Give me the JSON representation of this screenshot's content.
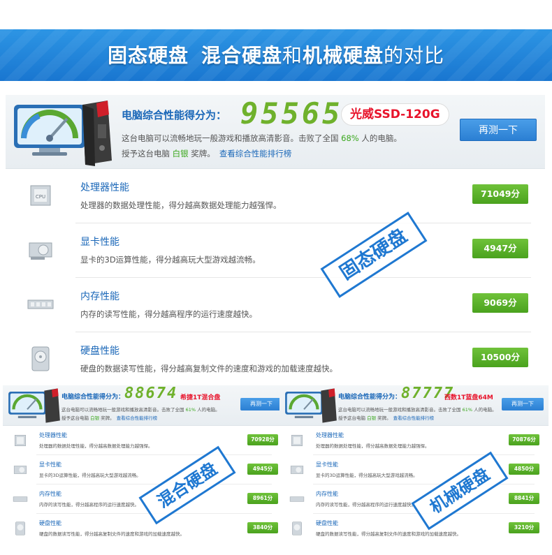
{
  "banner": {
    "part1": "固态硬盘",
    "part2": "混合硬盘",
    "part3": "和",
    "part4": "机械硬盘",
    "part5": "的对比"
  },
  "main": {
    "score_label": "电脑综合性能得分为：",
    "score": "95565",
    "model": "光威SSD-120G",
    "desc_before": "这台电脑可以流畅地玩一般游戏和播放高清影音。击败了全国 ",
    "pct": "68%",
    "desc_after": " 人的电脑。",
    "award_before": "授予这台电脑 ",
    "medal": "白银",
    "award_after": " 奖牌。",
    "rank_link": "查看综合性能排行榜",
    "retest": "再测一下",
    "rows": [
      {
        "title": "处理器性能",
        "desc": "处理器的数据处理性能，得分越高数据处理能力越强悍。",
        "score": "71049分"
      },
      {
        "title": "显卡性能",
        "desc": "显卡的3D运算性能，得分越高玩大型游戏越流畅。",
        "score": "4947分"
      },
      {
        "title": "内存性能",
        "desc": "内存的读写性能，得分越高程序的运行速度越快。",
        "score": "9069分"
      },
      {
        "title": "硬盘性能",
        "desc": "硬盘的数据读写性能，得分越高复制文件的速度和游戏的加载速度越快。",
        "score": "10500分"
      }
    ],
    "stamp": "固态硬盘"
  },
  "hybrid": {
    "score_label": "电脑综合性能得分为：",
    "score": "88674",
    "model": "希捷1T混合盘",
    "desc_before": "这台电脑可以流畅地玩一般游戏和播放高清影音。击败了全国 ",
    "pct": "61%",
    "desc_after": " 人的电脑。",
    "award_before": "授予这台电脑 ",
    "medal": "白银",
    "award_after": " 奖牌。",
    "rank_link": "查看综合性能排行榜",
    "retest": "再测一下",
    "rows": [
      {
        "title": "处理器性能",
        "desc": "处理器的数据处理性能，得分越高数据处理能力越强悍。",
        "score": "70928分"
      },
      {
        "title": "显卡性能",
        "desc": "显卡的3D运算性能，得分越高玩大型游戏越流畅。",
        "score": "4945分"
      },
      {
        "title": "内存性能",
        "desc": "内存的读写性能，得分越高程序的运行速度越快。",
        "score": "8961分"
      },
      {
        "title": "硬盘性能",
        "desc": "硬盘的数据读写性能，得分越高复制文件的速度和游戏的加载速度越快。",
        "score": "3840分"
      }
    ],
    "stamp": "混合硬盘"
  },
  "mechanical": {
    "score_label": "电脑综合性能得分为：",
    "score": "87777",
    "model": "西数1T蓝盘64M",
    "desc_before": "这台电脑可以流畅地玩一般游戏和播放高清影音。击败了全国 ",
    "pct": "61%",
    "desc_after": " 人的电脑。",
    "award_before": "授予这台电脑 ",
    "medal": "白银",
    "award_after": " 奖牌。",
    "rank_link": "查看综合性能排行榜",
    "retest": "再测一下",
    "rows": [
      {
        "title": "处理器性能",
        "desc": "处理器的数据处理性能，得分越高数据处理能力越强悍。",
        "score": "70876分"
      },
      {
        "title": "显卡性能",
        "desc": "显卡的3D运算性能，得分越高玩大型游戏越流畅。",
        "score": "4850分"
      },
      {
        "title": "内存性能",
        "desc": "内存的读写性能，得分越高程序的运行速度越快。",
        "score": "8841分"
      },
      {
        "title": "硬盘性能",
        "desc": "硬盘的数据读写性能，得分越高复制文件的速度和游戏的加载速度越快。",
        "score": "3210分"
      }
    ],
    "stamp": "机械硬盘"
  }
}
